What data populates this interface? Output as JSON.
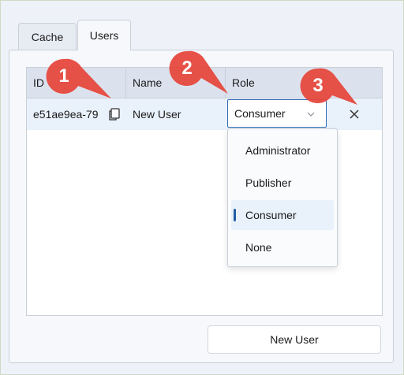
{
  "tabs": [
    {
      "label": "Cache"
    },
    {
      "label": "Users"
    }
  ],
  "table": {
    "columns": [
      "ID",
      "Name",
      "Role"
    ],
    "rows": [
      {
        "id": "e51ae9ea-79",
        "name": "New User",
        "role": "Consumer"
      }
    ]
  },
  "role_dropdown": {
    "options": [
      "Administrator",
      "Publisher",
      "Consumer",
      "None"
    ],
    "selected": "Consumer"
  },
  "new_user_button": {
    "label": "New User"
  },
  "markers": [
    "1",
    "2",
    "3"
  ],
  "colors": {
    "marker": "#e6483d",
    "accent": "#1f5fa8",
    "row_highlight": "#e9f1fb"
  },
  "icons": {
    "copy": "copy-icon",
    "chevron": "chevron-down-icon",
    "delete": "close-icon"
  }
}
